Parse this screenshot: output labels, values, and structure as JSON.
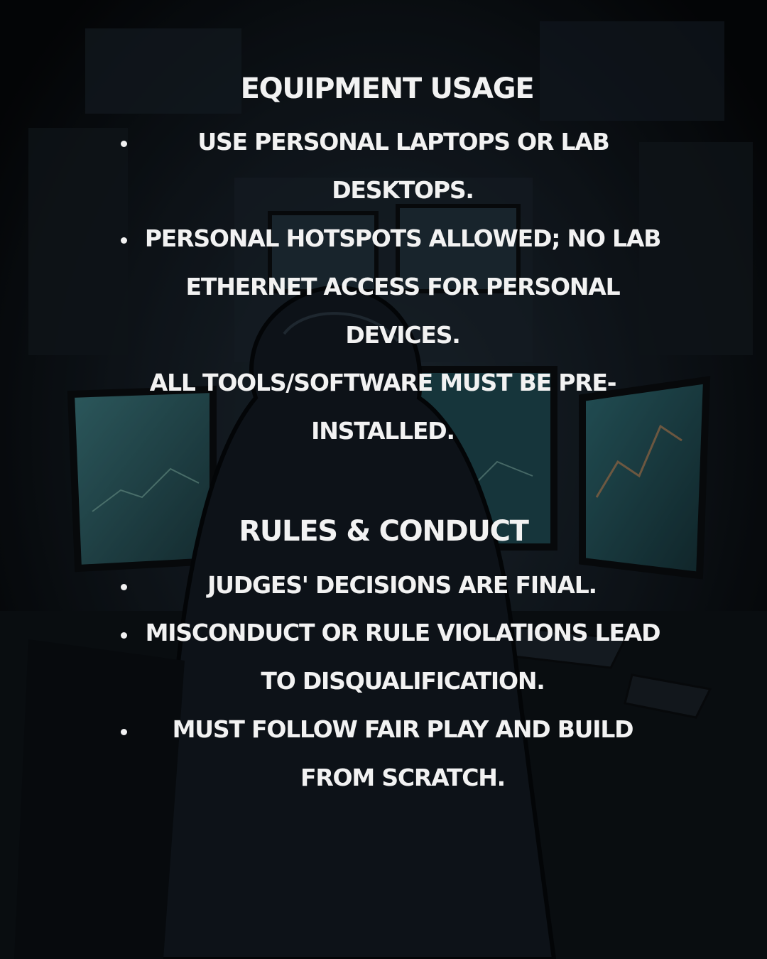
{
  "sections": [
    {
      "heading": "EQUIPMENT USAGE",
      "items": [
        {
          "lines": [
            "USE PERSONAL LAPTOPS OR LAB",
            "DESKTOPS."
          ]
        },
        {
          "lines": [
            "PERSONAL HOTSPOTS ALLOWED; NO LAB",
            "ETHERNET ACCESS FOR PERSONAL",
            "DEVICES."
          ]
        },
        {
          "lines": [
            "ALL TOOLS/SOFTWARE MUST BE PRE-",
            "INSTALLED."
          ]
        }
      ]
    },
    {
      "heading": "RULES & CONDUCT",
      "items": [
        {
          "lines": [
            "JUDGES' DECISIONS ARE FINAL."
          ]
        },
        {
          "lines": [
            "MISCONDUCT OR RULE VIOLATIONS LEAD",
            "TO DISQUALIFICATION."
          ]
        },
        {
          "lines": [
            "MUST FOLLOW FAIR PLAY AND BUILD",
            "FROM SCRATCH."
          ]
        }
      ]
    }
  ],
  "background": {
    "illustration": "hooded-hacker-at-computer-monitors",
    "base_color": "#0b0f14",
    "screen_color": "#2e5f66",
    "text_color": "#f2f2f2"
  }
}
